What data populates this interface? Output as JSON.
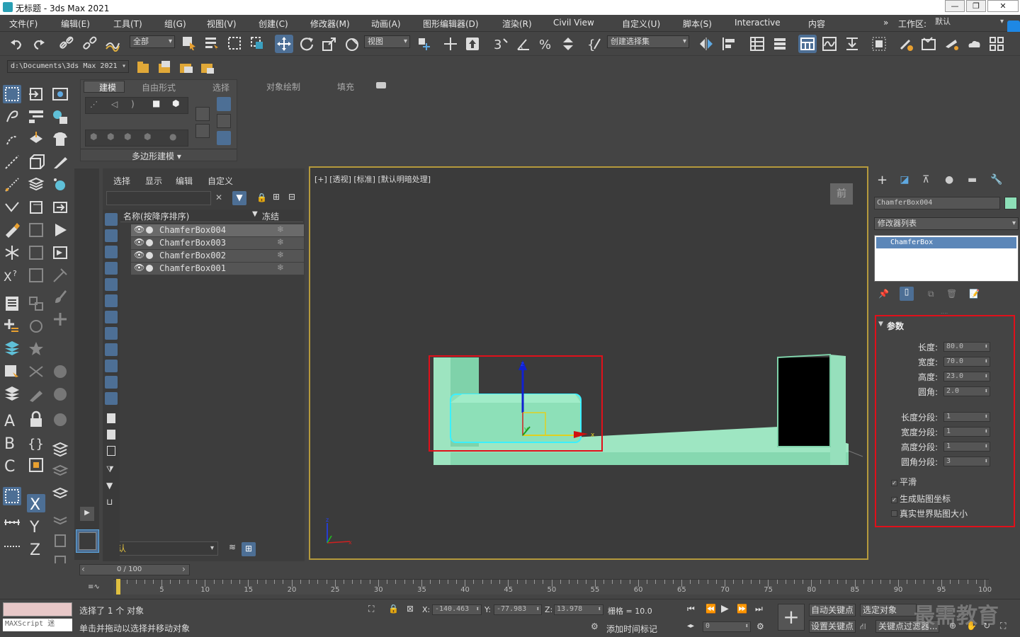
{
  "window": {
    "title": "无标题 - 3ds Max 2021",
    "minimize": "—",
    "maximize": "❐",
    "close": "✕"
  },
  "menus": [
    "文件(F)",
    "编辑(E)",
    "工具(T)",
    "组(G)",
    "视图(V)",
    "创建(C)",
    "修改器(M)",
    "动画(A)",
    "图形编辑器(D)",
    "渲染(R)",
    "Civil View",
    "自定义(U)",
    "脚本(S)",
    "Interactive",
    "内容"
  ],
  "workspace": {
    "label": "工作区:",
    "value": "默认",
    "more": "»"
  },
  "toolbar": {
    "selection_filter": "全部",
    "ref_coord": "视图",
    "named_selection": "创建选择集"
  },
  "project_path": "d:\\Documents\\3ds Max 2021",
  "ribbon": {
    "tabs": [
      "建模",
      "自由形式",
      "选择",
      "对象绘制",
      "填充"
    ],
    "active_tab": "建模",
    "panel_label": "多边形建模 ▾"
  },
  "scene_explorer": {
    "menus": [
      "选择",
      "显示",
      "编辑",
      "自定义"
    ],
    "col_name": "名称(按降序排序)",
    "col_freeze": "冻结",
    "layer": "默认",
    "rows": [
      {
        "name": "ChamferBox004",
        "selected": true
      },
      {
        "name": "ChamferBox003",
        "selected": false
      },
      {
        "name": "ChamferBox002",
        "selected": false
      },
      {
        "name": "ChamferBox001",
        "selected": false
      }
    ]
  },
  "viewport": {
    "label": "[+] [透视] [标准] [默认明暗处理]",
    "viewcube": "前"
  },
  "command_panel": {
    "object_name": "ChamferBox004",
    "modifier_list": "修改器列表",
    "stack_item": "ChamferBox",
    "rollout_title": "参数",
    "params": [
      {
        "label": "长度:",
        "value": "80.0"
      },
      {
        "label": "宽度:",
        "value": "70.0"
      },
      {
        "label": "高度:",
        "value": "23.0"
      },
      {
        "label": "圆角:",
        "value": "2.0"
      }
    ],
    "segments": [
      {
        "label": "长度分段:",
        "value": "1"
      },
      {
        "label": "宽度分段:",
        "value": "1"
      },
      {
        "label": "高度分段:",
        "value": "1"
      },
      {
        "label": "圆角分段:",
        "value": "3"
      }
    ],
    "checks": [
      {
        "label": "平滑",
        "checked": true
      },
      {
        "label": "生成贴图坐标",
        "checked": true
      },
      {
        "label": "真实世界贴图大小",
        "checked": false
      }
    ]
  },
  "timeline": {
    "frame": "0 / 100",
    "ticks": [
      "5",
      "10",
      "15",
      "20",
      "25",
      "30",
      "35",
      "40",
      "45",
      "50",
      "55",
      "60",
      "65",
      "70",
      "75",
      "80",
      "85",
      "90",
      "95",
      "100"
    ]
  },
  "status": {
    "maxscript": "MAXScript 迷",
    "selection": "选择了 1 个 对象",
    "hint": "单击并拖动以选择并移动对象",
    "x_label": "X:",
    "x": "-140.463",
    "y_label": "Y:",
    "y": "-77.983",
    "z_label": "Z:",
    "z": "13.978",
    "grid": "栅格 = 10.0",
    "add_time_tag": "添加时间标记",
    "auto_key": "自动关键点",
    "selected_obj": "选定对象",
    "set_key": "设置关键点",
    "key_filter": "关键点过滤器...",
    "frame_field": "0",
    "watermark": "最需教育"
  },
  "colors": {
    "accent": "#4d6f95",
    "selection_red": "#e0101a",
    "object": "#8de0b8",
    "viewport_border": "#b59a3c"
  }
}
